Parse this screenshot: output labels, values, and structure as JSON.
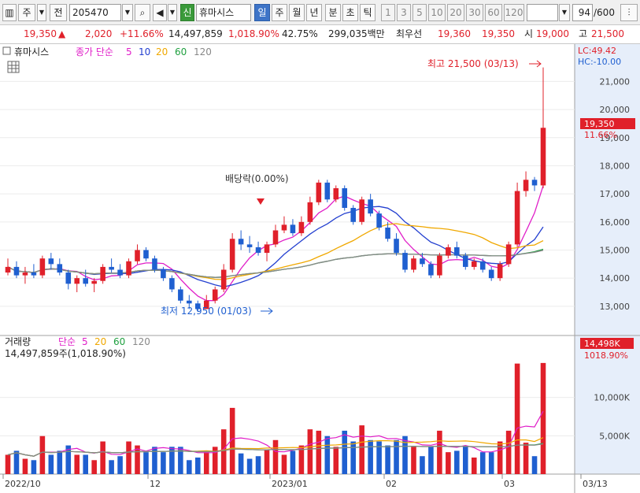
{
  "toolbar": {
    "market_code": "주",
    "prev_label": "전",
    "stock_code": "205470",
    "stock_name_badge": "신",
    "stock_name": "휴마시스",
    "period_tabs": [
      "일",
      "주",
      "월",
      "년",
      "분",
      "초",
      "틱"
    ],
    "active_period": "일",
    "interval_buttons": [
      "1",
      "3",
      "5",
      "10",
      "20",
      "30",
      "60",
      "120"
    ],
    "count_value": "94",
    "count_total": "/600"
  },
  "price_bar": {
    "price": "19,350",
    "arrow": "▲",
    "change": "2,020",
    "change_pct": "+11.66%",
    "volume": "14,497,859",
    "volume_ratio": "1,018.90%",
    "turnover": "42.75%",
    "amount": "299,035백만",
    "best_ask_label": "최우선",
    "ask": "19,360",
    "bid": "19,350",
    "open_label": "시",
    "open": "19,000",
    "high_label": "고",
    "high": "21,500"
  },
  "price_panel": {
    "name": "휴마시스",
    "legend_type": "종가 단순",
    "ma_periods": [
      "5",
      "10",
      "20",
      "60",
      "120"
    ],
    "ma_colors": [
      "#e01ec8",
      "#2440d0",
      "#f0a800",
      "#20a040",
      "#888888"
    ],
    "lc": "LC:49.42",
    "hc": "HC:-10.00",
    "max_label": "최고 21,500 (03/13)",
    "min_label": "최저 12,950 (01/03)",
    "event_label": "배당락(0.00%)",
    "last_price_tag": "19,350",
    "last_pct_tag": "11.66%",
    "y_ticks": [
      "21,000",
      "20,000",
      "19,000",
      "18,000",
      "17,000",
      "16,000",
      "15,000",
      "14,000",
      "13,000"
    ]
  },
  "volume_panel": {
    "title": "거래량",
    "legend_type": "단순",
    "ma_periods": [
      "5",
      "20",
      "60",
      "120"
    ],
    "volume_text": "14,497,859주(1,018.90%)",
    "last_tag": "14,498K",
    "last_pct": "1018.90%",
    "y_ticks": [
      "10,000K",
      "5,000K"
    ]
  },
  "x_axis": {
    "labels": [
      "2022/10",
      "12",
      "2023/01",
      "02",
      "03",
      "03/13"
    ]
  },
  "colors": {
    "up": "#e0202a",
    "down": "#1f5fd0",
    "axis_bg": "#e6eefa"
  },
  "chart_data": {
    "type": "candlestick",
    "ylim_price": [
      12800,
      21600
    ],
    "ylim_volume": [
      0,
      15000000
    ],
    "series": [
      {
        "name": "OHLC",
        "values": [
          [
            14200,
            14700,
            14100,
            14400
          ],
          [
            14400,
            14600,
            14000,
            14100
          ],
          [
            14100,
            14400,
            13800,
            14200
          ],
          [
            14200,
            14500,
            14000,
            14100
          ],
          [
            14100,
            14800,
            14000,
            14700
          ],
          [
            14700,
            14900,
            14300,
            14500
          ],
          [
            14500,
            14700,
            14100,
            14200
          ],
          [
            14200,
            14300,
            13600,
            13800
          ],
          [
            13800,
            14100,
            13500,
            14000
          ],
          [
            14000,
            14300,
            13700,
            13800
          ],
          [
            13800,
            14000,
            13500,
            13900
          ],
          [
            13900,
            14500,
            13800,
            14400
          ],
          [
            14400,
            14700,
            14200,
            14300
          ],
          [
            14300,
            14500,
            14000,
            14100
          ],
          [
            14100,
            14700,
            14000,
            14600
          ],
          [
            14600,
            15200,
            14500,
            15000
          ],
          [
            15000,
            15100,
            14600,
            14700
          ],
          [
            14700,
            14800,
            14200,
            14300
          ],
          [
            14300,
            14400,
            13900,
            14000
          ],
          [
            14000,
            14100,
            13500,
            13600
          ],
          [
            13600,
            13700,
            13100,
            13200
          ],
          [
            13200,
            13400,
            12900,
            13100
          ],
          [
            13100,
            13200,
            12800,
            12900
          ],
          [
            12900,
            13400,
            12900,
            13200
          ],
          [
            13200,
            13700,
            13100,
            13600
          ],
          [
            13600,
            14500,
            13500,
            14300
          ],
          [
            14300,
            15600,
            14200,
            15400
          ],
          [
            15400,
            15700,
            15000,
            15200
          ],
          [
            15200,
            15500,
            14900,
            15100
          ],
          [
            15100,
            15300,
            14800,
            14900
          ],
          [
            14900,
            15300,
            14600,
            15200
          ],
          [
            15200,
            15900,
            15100,
            15700
          ],
          [
            15700,
            16200,
            15600,
            15900
          ],
          [
            15900,
            16100,
            15500,
            15600
          ],
          [
            15600,
            16200,
            15500,
            16000
          ],
          [
            16000,
            16900,
            15900,
            16700
          ],
          [
            16700,
            17500,
            16600,
            17400
          ],
          [
            17400,
            17500,
            16700,
            16800
          ],
          [
            16800,
            17300,
            16700,
            17200
          ],
          [
            17200,
            17300,
            16400,
            16500
          ],
          [
            16500,
            16600,
            15900,
            16000
          ],
          [
            16000,
            16900,
            15900,
            16800
          ],
          [
            16800,
            17000,
            16200,
            16300
          ],
          [
            16300,
            16400,
            15700,
            15800
          ],
          [
            15800,
            16000,
            15300,
            15400
          ],
          [
            15400,
            15600,
            14800,
            14900
          ],
          [
            14900,
            15000,
            14200,
            14300
          ],
          [
            14300,
            14800,
            14200,
            14700
          ],
          [
            14700,
            14900,
            14400,
            14500
          ],
          [
            14500,
            14600,
            14000,
            14100
          ],
          [
            14100,
            14900,
            14000,
            14800
          ],
          [
            14800,
            15200,
            14700,
            15100
          ],
          [
            15100,
            15300,
            14700,
            14800
          ],
          [
            14800,
            14900,
            14300,
            14400
          ],
          [
            14400,
            14700,
            14300,
            14600
          ],
          [
            14600,
            14700,
            14200,
            14300
          ],
          [
            14300,
            14400,
            13900,
            14000
          ],
          [
            14000,
            14600,
            13900,
            14500
          ],
          [
            14500,
            15300,
            14400,
            15200
          ],
          [
            15200,
            17400,
            15100,
            17100
          ],
          [
            17100,
            17800,
            16900,
            17500
          ],
          [
            17500,
            17600,
            17100,
            17300
          ],
          [
            17300,
            21500,
            17200,
            19350
          ]
        ]
      }
    ]
  }
}
